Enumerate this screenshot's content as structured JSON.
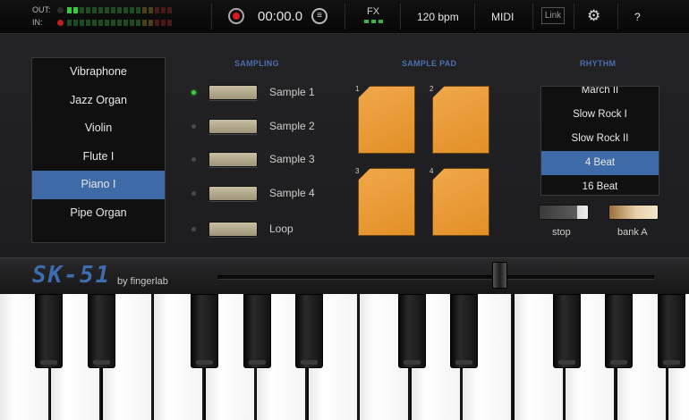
{
  "topbar": {
    "out_label": "OUT:",
    "in_label": "IN:",
    "time": "00:00.0",
    "fx_label": "FX",
    "bpm": "120 bpm",
    "midi": "MIDI",
    "link": "Link",
    "help": "?",
    "icons": [
      "record-icon",
      "list-icon",
      "gear-icon"
    ]
  },
  "instruments": {
    "items": [
      "Vibraphone",
      "Jazz Organ",
      "Violin",
      "Flute I",
      "Piano I",
      "Pipe Organ"
    ],
    "selected": "Piano I"
  },
  "sampling": {
    "title": "SAMPLING",
    "rows": [
      {
        "label": "Sample 1",
        "active": true
      },
      {
        "label": "Sample 2",
        "active": false
      },
      {
        "label": "Sample 3",
        "active": false
      },
      {
        "label": "Sample 4",
        "active": false
      },
      {
        "label": "Loop",
        "active": false
      }
    ]
  },
  "sample_pad": {
    "title": "SAMPLE PAD",
    "pads": [
      "1",
      "2",
      "3",
      "4"
    ],
    "color": "#e8992f"
  },
  "rhythm": {
    "title": "RHYTHM",
    "items": [
      "March II",
      "Slow Rock I",
      "Slow Rock II",
      "4 Beat",
      "16 Beat"
    ],
    "selected": "4 Beat",
    "stop_label": "stop",
    "bank_label": "bank A"
  },
  "brand": {
    "logo": "SK-51",
    "byline": "by fingerlab",
    "accent": "#3e6aa8"
  }
}
